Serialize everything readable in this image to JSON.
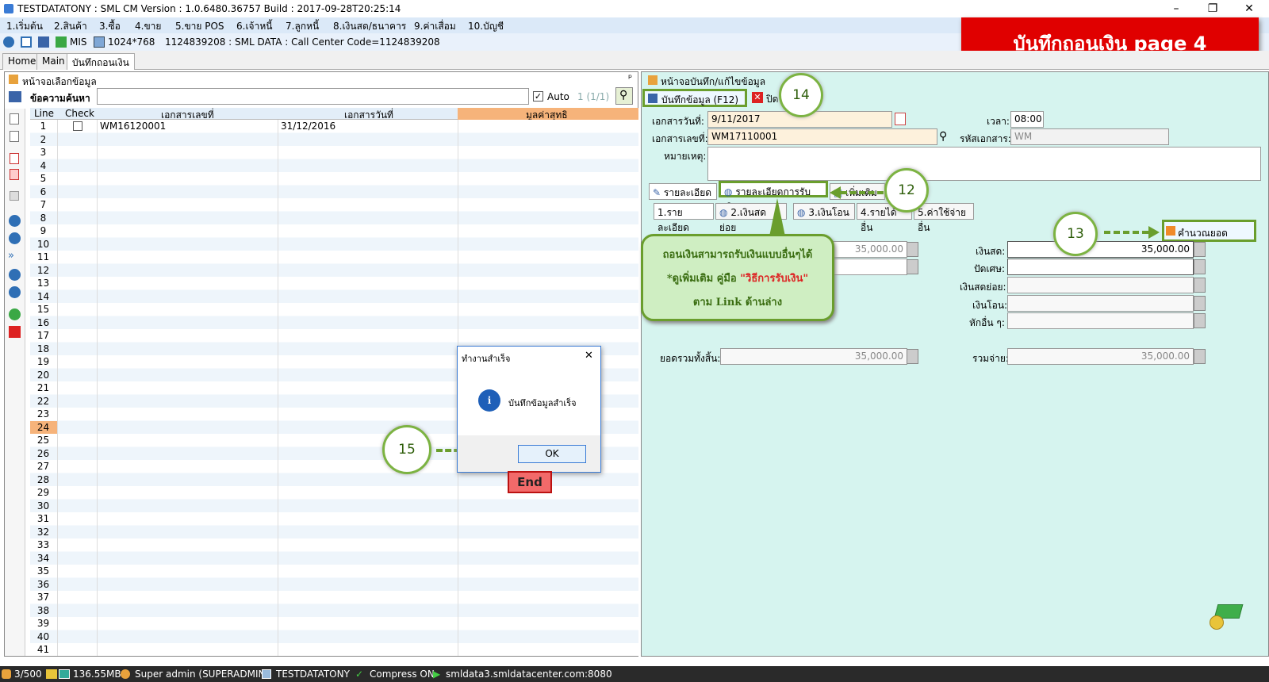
{
  "window": {
    "title": "TESTDATATONY : SML CM Version : 1.0.6480.36757  Build : 2017-09-28T20:25:14",
    "minimize": "–",
    "restore": "❐",
    "close": "✕"
  },
  "menu": [
    "1.เริ่มต้น",
    "2.สินค้า",
    "3.ซื้อ",
    "4.ขาย",
    "5.ขาย POS",
    "6.เจ้าหนี้",
    "7.ลูกหนี้",
    "8.เงินสด/ธนาคาร",
    "9.ค่าเสื่อม",
    "10.บัญชี"
  ],
  "toolbar": {
    "mis": "MIS",
    "resolution": "1024*768",
    "info": "1124839208 : SML DATA : Call Center Code=1124839208"
  },
  "banner": {
    "text": "บันทึกถอนเงิน page 4",
    "color": "#e00000"
  },
  "tabs": [
    "Home",
    "Main",
    "บันทึกถอนเงิน"
  ],
  "left": {
    "header": "หน้าจอเลือกข้อมูล",
    "pin": "ᵖ",
    "search_label": "ข้อความค้นหา",
    "search_value": "",
    "auto_label": "Auto",
    "auto_checked": true,
    "page_info": "1 (1/1)",
    "columns": [
      "Line",
      "Check",
      "เอกสารเลขที่",
      "เอกสารวันที่",
      "มูลค่าสุทธิ"
    ],
    "row1": {
      "line": "1",
      "doc_no": "WM16120001",
      "doc_date": "31/12/2016",
      "net_value": ""
    },
    "line_numbers": [
      "1",
      "2",
      "3",
      "4",
      "5",
      "6",
      "7",
      "8",
      "9",
      "10",
      "11",
      "12",
      "13",
      "14",
      "15",
      "16",
      "17",
      "18",
      "19",
      "20",
      "21",
      "22",
      "23",
      "24",
      "25",
      "26",
      "27",
      "28",
      "29",
      "30",
      "31",
      "32",
      "33",
      "34",
      "35",
      "36",
      "37",
      "38",
      "39",
      "40",
      "41"
    ],
    "selected_row": "24"
  },
  "right": {
    "header": "หน้าจอบันทึก/แก้ไขข้อมูล",
    "save_button": "บันทึกข้อมูล (F12)",
    "close_button": "ปิด",
    "doc_date_label": "เอกสารวันที่:",
    "doc_date_value": "9/11/2017",
    "time_label": "เวลา:",
    "time_value": "08:00",
    "doc_no_label": "เอกสารเลขที่:",
    "doc_no_value": "WM17110001",
    "doc_code_label": "รหัสเอกสาร:",
    "doc_code_value": "WM",
    "remark_label": "หมายเหตุ:",
    "remark_value": "",
    "tabs": [
      "รายละเอียด",
      "รายละเอียดการรับเงิน",
      "เพิ่มเติม"
    ],
    "subtabs": [
      "1.รายละเอียด",
      "2.เงินสดย่อย",
      "3.เงินโอน",
      "4.รายได้อื่น",
      "5.ค่าใช้จ่ายอื่น"
    ],
    "calc_button": "คำนวณยอดเงินสด",
    "left_amount1": "35,000.00",
    "left_amount2": "",
    "total_label": "ยอดรวมทั้งสิ้น:",
    "total_value": "35,000.00",
    "cash_label": "เงินสด:",
    "cash_value": "35,000.00",
    "rounding_label": "ปัดเศษ:",
    "rounding_value": "",
    "petty_label": "เงินสดย่อย:",
    "petty_value": "",
    "transfer_label": "เงินโอน:",
    "transfer_value": "",
    "deduct_label": "หักอื่น ๆ:",
    "deduct_value": "",
    "paytotal_label": "รวมจ่าย:",
    "paytotal_value": "35,000.00"
  },
  "callout": {
    "line1": "ถอนเงินสามารถรับเงินแบบอื่นๆได้",
    "line2a": "*ดูเพิ่มเติม  คู่มือ ",
    "line2b": "\"วิธีการรับเงิน\"",
    "line3": "ตาม Link ด้านล่าง"
  },
  "markers": [
    "14",
    "12",
    "13",
    "15"
  ],
  "dialog": {
    "title": "ทำงานสำเร็จ",
    "close": "✕",
    "message": "บันทึกข้อมูลสำเร็จ",
    "ok": "OK",
    "info_icon": "i"
  },
  "end_label": "End",
  "status": {
    "count": "3/500",
    "memory": "136.55MB",
    "user": "Super admin (SUPERADMIN)",
    "db": "TESTDATATONY",
    "compress": "Compress ON",
    "server": "smldata3.smldatacenter.com:8080"
  }
}
